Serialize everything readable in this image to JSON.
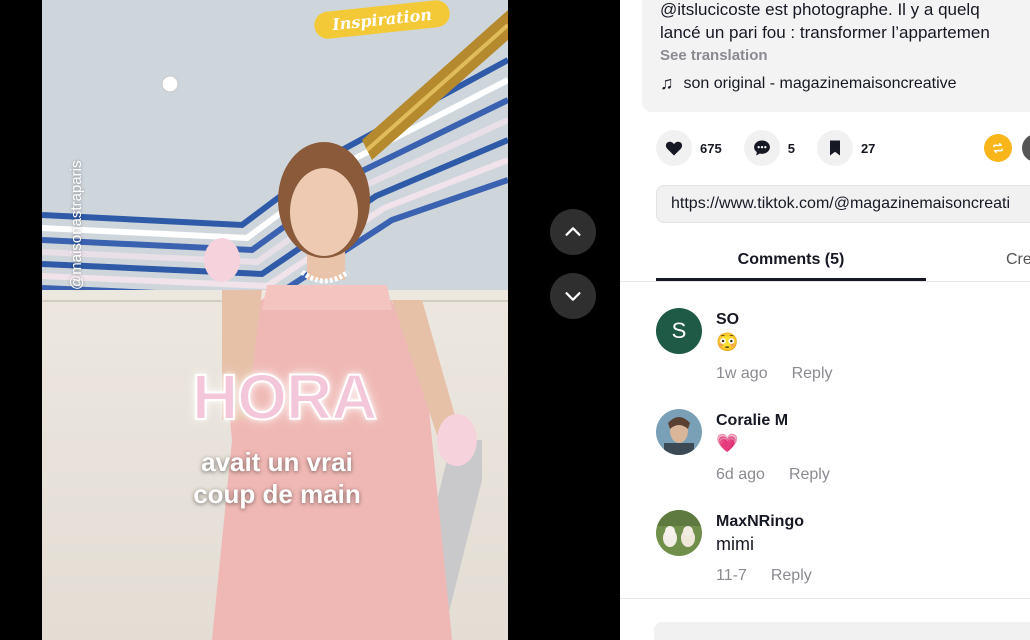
{
  "video": {
    "tag": "Inspiration",
    "handle_overlay": "@maisonastraparis",
    "big_word": "HORA",
    "caption_line1": "avait un vrai",
    "caption_line2": "coup de main"
  },
  "description": {
    "line1": "@itslucicoste est photographe. Il y a quelq",
    "line2": "lancé un pari fou : transformer l’appartemen",
    "see_translation": "See translation",
    "music": "son original - magazinemaisoncreative"
  },
  "actions": {
    "likes": "675",
    "comments": "5",
    "saves": "27"
  },
  "share_url": "https://www.tiktok.com/@magazinemaisoncreati",
  "tabs": {
    "comments": "Comments (5)",
    "creator": "Cre"
  },
  "comments": [
    {
      "user": "SO",
      "avatar_letter": "S",
      "text": "😳",
      "time": "1w ago",
      "reply": "Reply"
    },
    {
      "user": "Coralie M",
      "text": "💗",
      "time": "6d ago",
      "reply": "Reply"
    },
    {
      "user": "MaxNRingo",
      "text": "mimi",
      "time": "11-7",
      "reply": "Reply"
    }
  ],
  "colors": {
    "tag_yellow": "#f4c937",
    "share_orange": "#f8b61a",
    "avatar_green": "#1e5a45"
  }
}
